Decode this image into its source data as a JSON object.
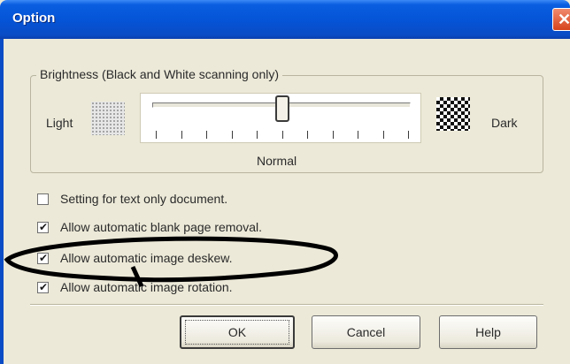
{
  "window": {
    "title": "Option"
  },
  "brightness": {
    "group_label": "Brightness (Black and White scanning only)",
    "light_label": "Light",
    "dark_label": "Dark",
    "normal_label": "Normal",
    "slider_value_fraction": 0.5,
    "tick_count": 11
  },
  "options": [
    {
      "label": "Setting for text only document.",
      "checked": false
    },
    {
      "label": "Allow automatic blank page removal.",
      "checked": true
    },
    {
      "label": "Allow automatic image deskew.",
      "checked": true,
      "highlighted": true
    },
    {
      "label": "Allow automatic image rotation.",
      "checked": true
    }
  ],
  "buttons": {
    "ok": "OK",
    "cancel": "Cancel",
    "help": "Help"
  },
  "icons": {
    "close": "close-icon",
    "check": "checkmark-icon"
  },
  "colors": {
    "titlebar": "#0553d6",
    "dialog_bg": "#ece9d8",
    "annotation": "#000000"
  }
}
